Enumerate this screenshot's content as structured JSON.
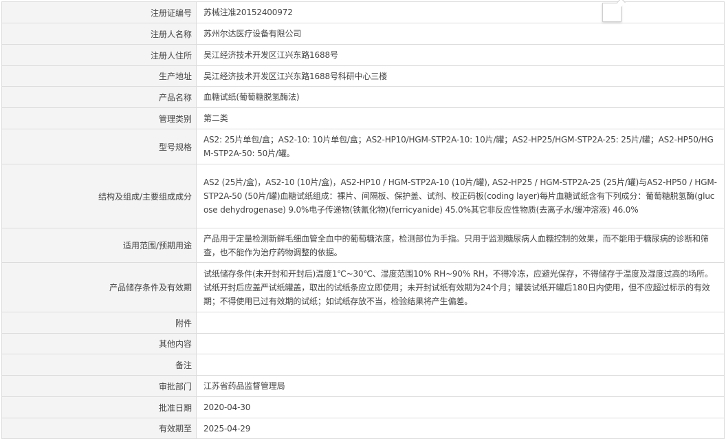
{
  "rows": [
    {
      "label": "注册证编号",
      "value": "苏械注准20152400972"
    },
    {
      "label": "注册人名称",
      "value": "苏州尔达医疗设备有限公司"
    },
    {
      "label": "注册人住所",
      "value": "吴江经济技术开发区江兴东路1688号"
    },
    {
      "label": "生产地址",
      "value": "吴江经济技术开发区江兴东路1688号科研中心三楼"
    },
    {
      "label": "产品名称",
      "value": "血糖试纸(葡萄糖脱氢酶法)"
    },
    {
      "label": "管理类别",
      "value": "第二类"
    },
    {
      "label": "型号规格",
      "value": "AS2: 25片单包/盒；AS2-10: 10片单包/盒；AS2-HP10/HGM-STP2A-10: 10片/罐；AS2-HP25/HGM-STP2A-25: 25片/罐；AS2-HP50/HGM-STP2A-50: 50片/罐。"
    },
    {
      "label": "结构及组成/主要组成成分",
      "value": "AS2 (25片/盒)，AS2-10 (10片/盒)，AS2-HP10 / HGM-STP2A-10 (10片/罐), AS2-HP25 / HGM-STP2A-25 (25片/罐)与AS2-HP50 / HGM-STP2A-50 (50片/罐)血糖试纸组成：裸片、间隔板、保护盖、试剂、校正码板(coding layer)每片血糖试纸含有下列成分：葡萄糖脱氢酶(glucose dehydrogenase) 9.0%电子传递物(铁氰化物)(ferricyanide) 45.0%其它非反应性物质(去离子水/缓冲溶液) 46.0%"
    },
    {
      "label": "适用范围/预期用途",
      "value": "产品用于定量检测新鲜毛细血管全血中的葡萄糖浓度，检测部位为手指。只用于监测糖尿病人血糖控制的效果，而不能用于糖尿病的诊断和筛查，也不能作为治疗药物调整的依据。"
    },
    {
      "label": "产品储存条件及有效期",
      "value": "试纸储存条件(未开封和开封后)温度1℃~30℃、湿度范围10% RH~90% RH，不得冷冻，应避光保存，不得储存于温度及湿度过高的场所。试纸开封后应盖严试纸罐盖，取出的试纸条应立即使用；未开封试纸有效期为24个月；罐装试纸开罐后180日内使用，但不应超过标示的有效期；不得使用已过有效期的试纸；如试纸存放不当，检验结果将产生偏差。"
    },
    {
      "label": "附件",
      "value": ""
    },
    {
      "label": "其他内容",
      "value": ""
    },
    {
      "label": "备注",
      "value": ""
    },
    {
      "label": "审批部门",
      "value": "江苏省药品监督管理局"
    },
    {
      "label": "批准日期",
      "value": "2020-04-30"
    },
    {
      "label": "有效期至",
      "value": "2025-04-29"
    }
  ]
}
